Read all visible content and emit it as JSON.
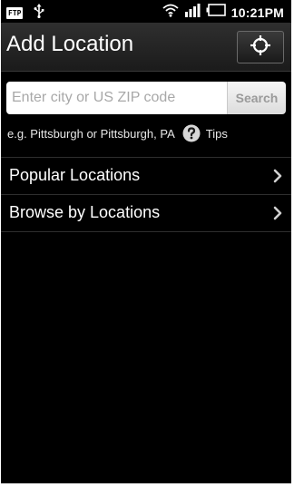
{
  "status_bar": {
    "ftp_label": "FTP",
    "icons": [
      "ftp-icon",
      "usb-icon",
      "wifi-icon",
      "signal-icon",
      "battery-icon"
    ],
    "time": "10:21PM"
  },
  "header": {
    "title": "Add Location",
    "locate_icon": "crosshair-icon"
  },
  "search": {
    "placeholder": "Enter city or US ZIP code",
    "value": "",
    "button_label": "Search"
  },
  "hint": {
    "example_text": "e.g. Pittsburgh or Pittsburgh, PA",
    "help_icon": "question-icon",
    "tips_label": "Tips"
  },
  "menu": {
    "items": [
      {
        "label": "Popular Locations"
      },
      {
        "label": "Browse by Locations"
      }
    ]
  },
  "colors": {
    "background": "#000000",
    "title_bar": "#262626",
    "text": "#ffffff",
    "search_button_text": "#9a9a9a",
    "placeholder": "#a8a8a8"
  }
}
